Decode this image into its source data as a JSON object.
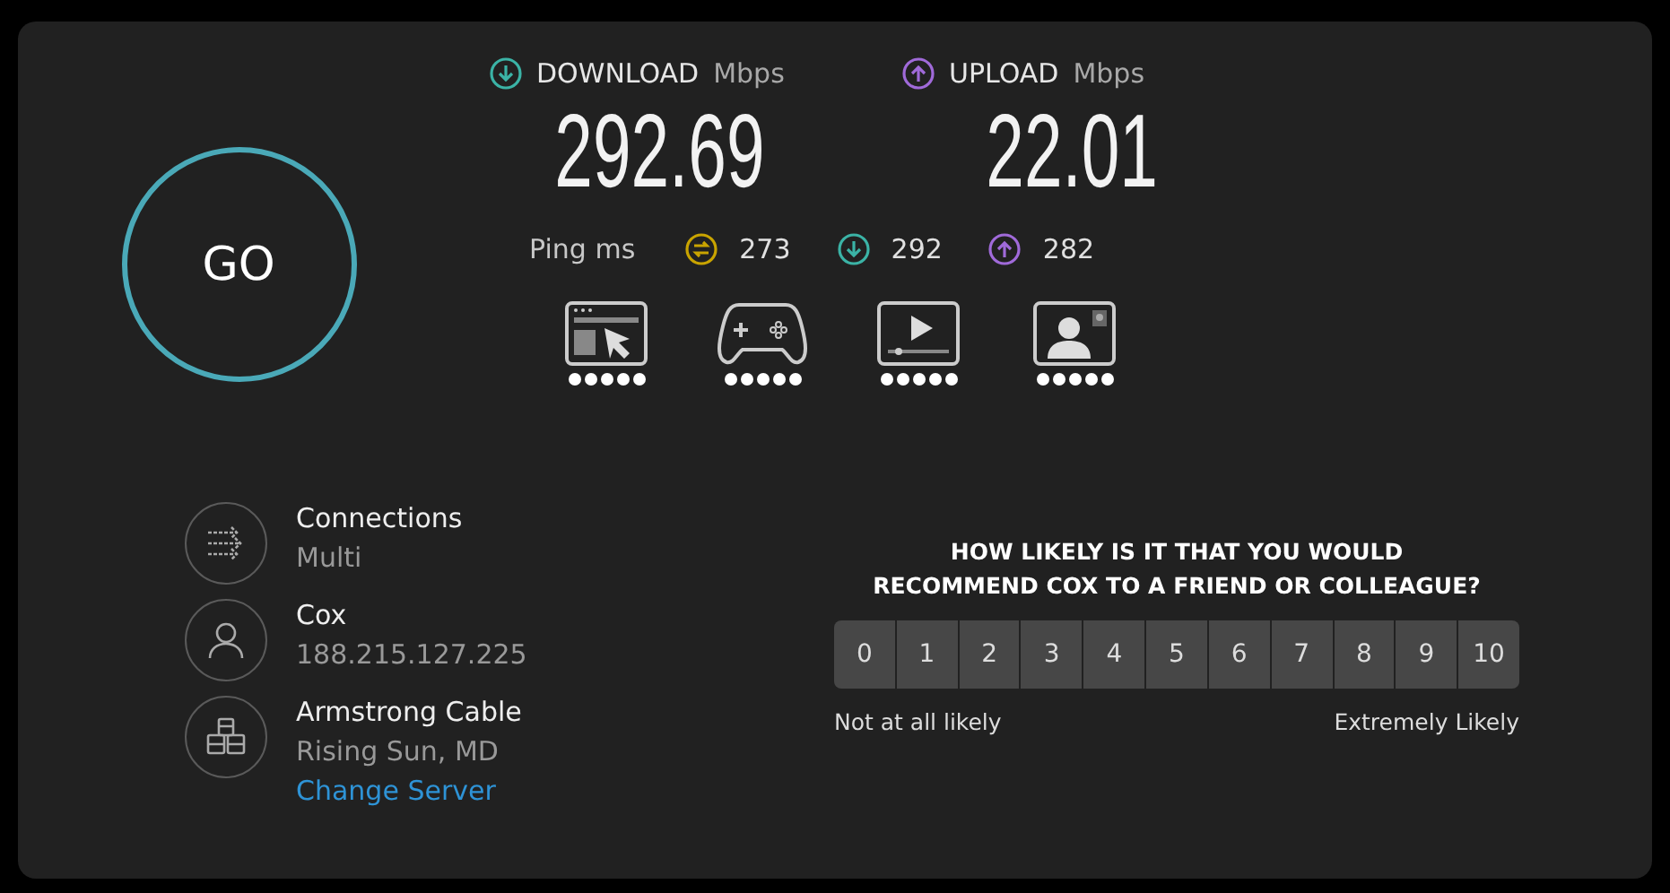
{
  "go_button": {
    "label": "GO"
  },
  "speeds": [
    {
      "kind": "download",
      "label": "DOWNLOAD",
      "unit": "Mbps",
      "value": "292.69"
    },
    {
      "kind": "upload",
      "label": "UPLOAD",
      "unit": "Mbps",
      "value": "22.01"
    }
  ],
  "ping": {
    "label": "Ping",
    "unit": "ms",
    "items": [
      {
        "kind": "jitter",
        "value": "273"
      },
      {
        "kind": "download",
        "value": "292"
      },
      {
        "kind": "upload",
        "value": "282"
      }
    ]
  },
  "activities": [
    {
      "kind": "browsing",
      "stars": 5
    },
    {
      "kind": "gaming",
      "stars": 5
    },
    {
      "kind": "video",
      "stars": 5
    },
    {
      "kind": "call",
      "stars": 5
    }
  ],
  "info": [
    {
      "kind": "connections",
      "title": "Connections",
      "detail": "Multi"
    },
    {
      "kind": "provider",
      "title": "Cox",
      "detail": "188.215.127.225"
    },
    {
      "kind": "server",
      "title": "Armstrong Cable",
      "detail": "Rising Sun, MD",
      "link": "Change Server"
    }
  ],
  "survey": {
    "question_lines": [
      "HOW LIKELY IS IT THAT YOU WOULD",
      "RECOMMEND COX TO A FRIEND OR COLLEAGUE?"
    ],
    "options": [
      "0",
      "1",
      "2",
      "3",
      "4",
      "5",
      "6",
      "7",
      "8",
      "9",
      "10"
    ],
    "low_label": "Not at all likely",
    "high_label": "Extremely Likely"
  }
}
